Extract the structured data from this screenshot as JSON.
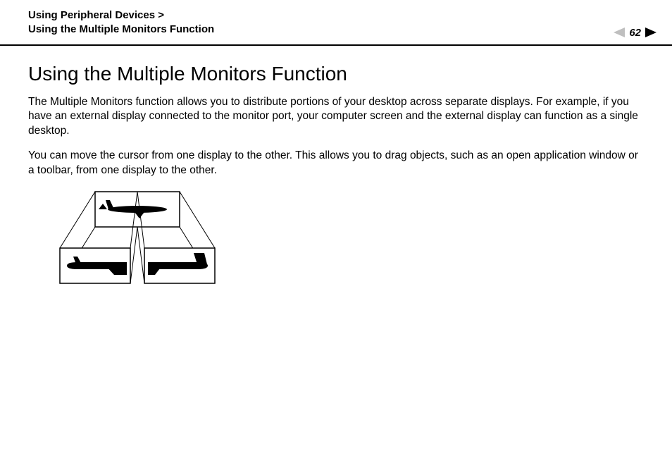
{
  "header": {
    "breadcrumb_line1": "Using Peripheral Devices >",
    "breadcrumb_line2": "Using the Multiple Monitors Function",
    "page_number": "62"
  },
  "main": {
    "title": "Using the Multiple Monitors Function",
    "paragraph1": "The Multiple Monitors function allows you to distribute portions of your desktop across separate displays. For example, if you have an external display connected to the monitor port, your computer screen and the external display can function as a single desktop.",
    "paragraph2": "You can move the cursor from one display to the other. This allows you to drag objects, such as an open application window or a toolbar, from one display to the other."
  },
  "icons": {
    "prev": "prev-page-icon",
    "next": "next-page-icon",
    "diagram": "multiple-monitors-diagram"
  }
}
